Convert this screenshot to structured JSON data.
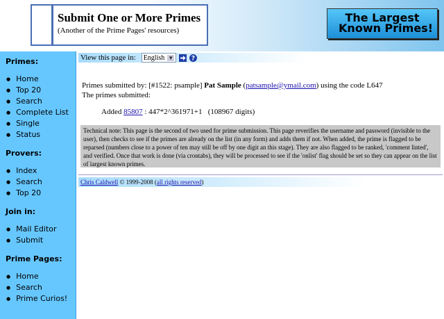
{
  "header": {
    "title": "Submit One or More Primes",
    "subtitle": "(Another of the Prime Pages' resources)",
    "logo_line1": "The Largest",
    "logo_line2": "Known Primes!"
  },
  "sidebar": {
    "primes": {
      "heading": "Primes:",
      "items": [
        "Home",
        "Top 20",
        "Search",
        "Complete List",
        "Single",
        "Status"
      ]
    },
    "provers": {
      "heading": "Provers:",
      "items": [
        "Index",
        "Search",
        "Top 20"
      ]
    },
    "join": {
      "heading": "Join in:",
      "items": [
        "Mail Editor",
        "Submit"
      ]
    },
    "prime_pages": {
      "heading": "Prime Pages:",
      "items": [
        "Home",
        "Search",
        "Prime Curios!"
      ]
    }
  },
  "language": {
    "label": "View this page in:",
    "selected": "English"
  },
  "submission": {
    "prefix": "Primes submitted by: [#1522: psample]",
    "name": "Pat Sample",
    "email": "patsample@ymail.com",
    "code_text": "using the code L647",
    "primes_label": "The primes submitted:",
    "added_label": "Added",
    "prime_id": "85807",
    "prime_expr": ": 447*2^361971+1",
    "digits": "(108967 digits)"
  },
  "tech_note": "Technical note: This page is the second of two used for prime submission.  This page reverifies the username and password (invisible to the user), then checks to see if the primes are already on the list (in any form) and adds them if not.  When added, the prime is flagged to be reparsed (numbers close to a power of ten may still be off by one digit an this stage).  They are also flagged to be ranked, 'comment linted', and verified.  Once that work is done (via crontabs), they will be processed to see if the 'onlist' flag should be set so they can appear on the list of largest known primes.",
  "footer": {
    "author": "Chris Caldwell",
    "years": "© 1999-2008",
    "rights": "all rights reserved"
  }
}
